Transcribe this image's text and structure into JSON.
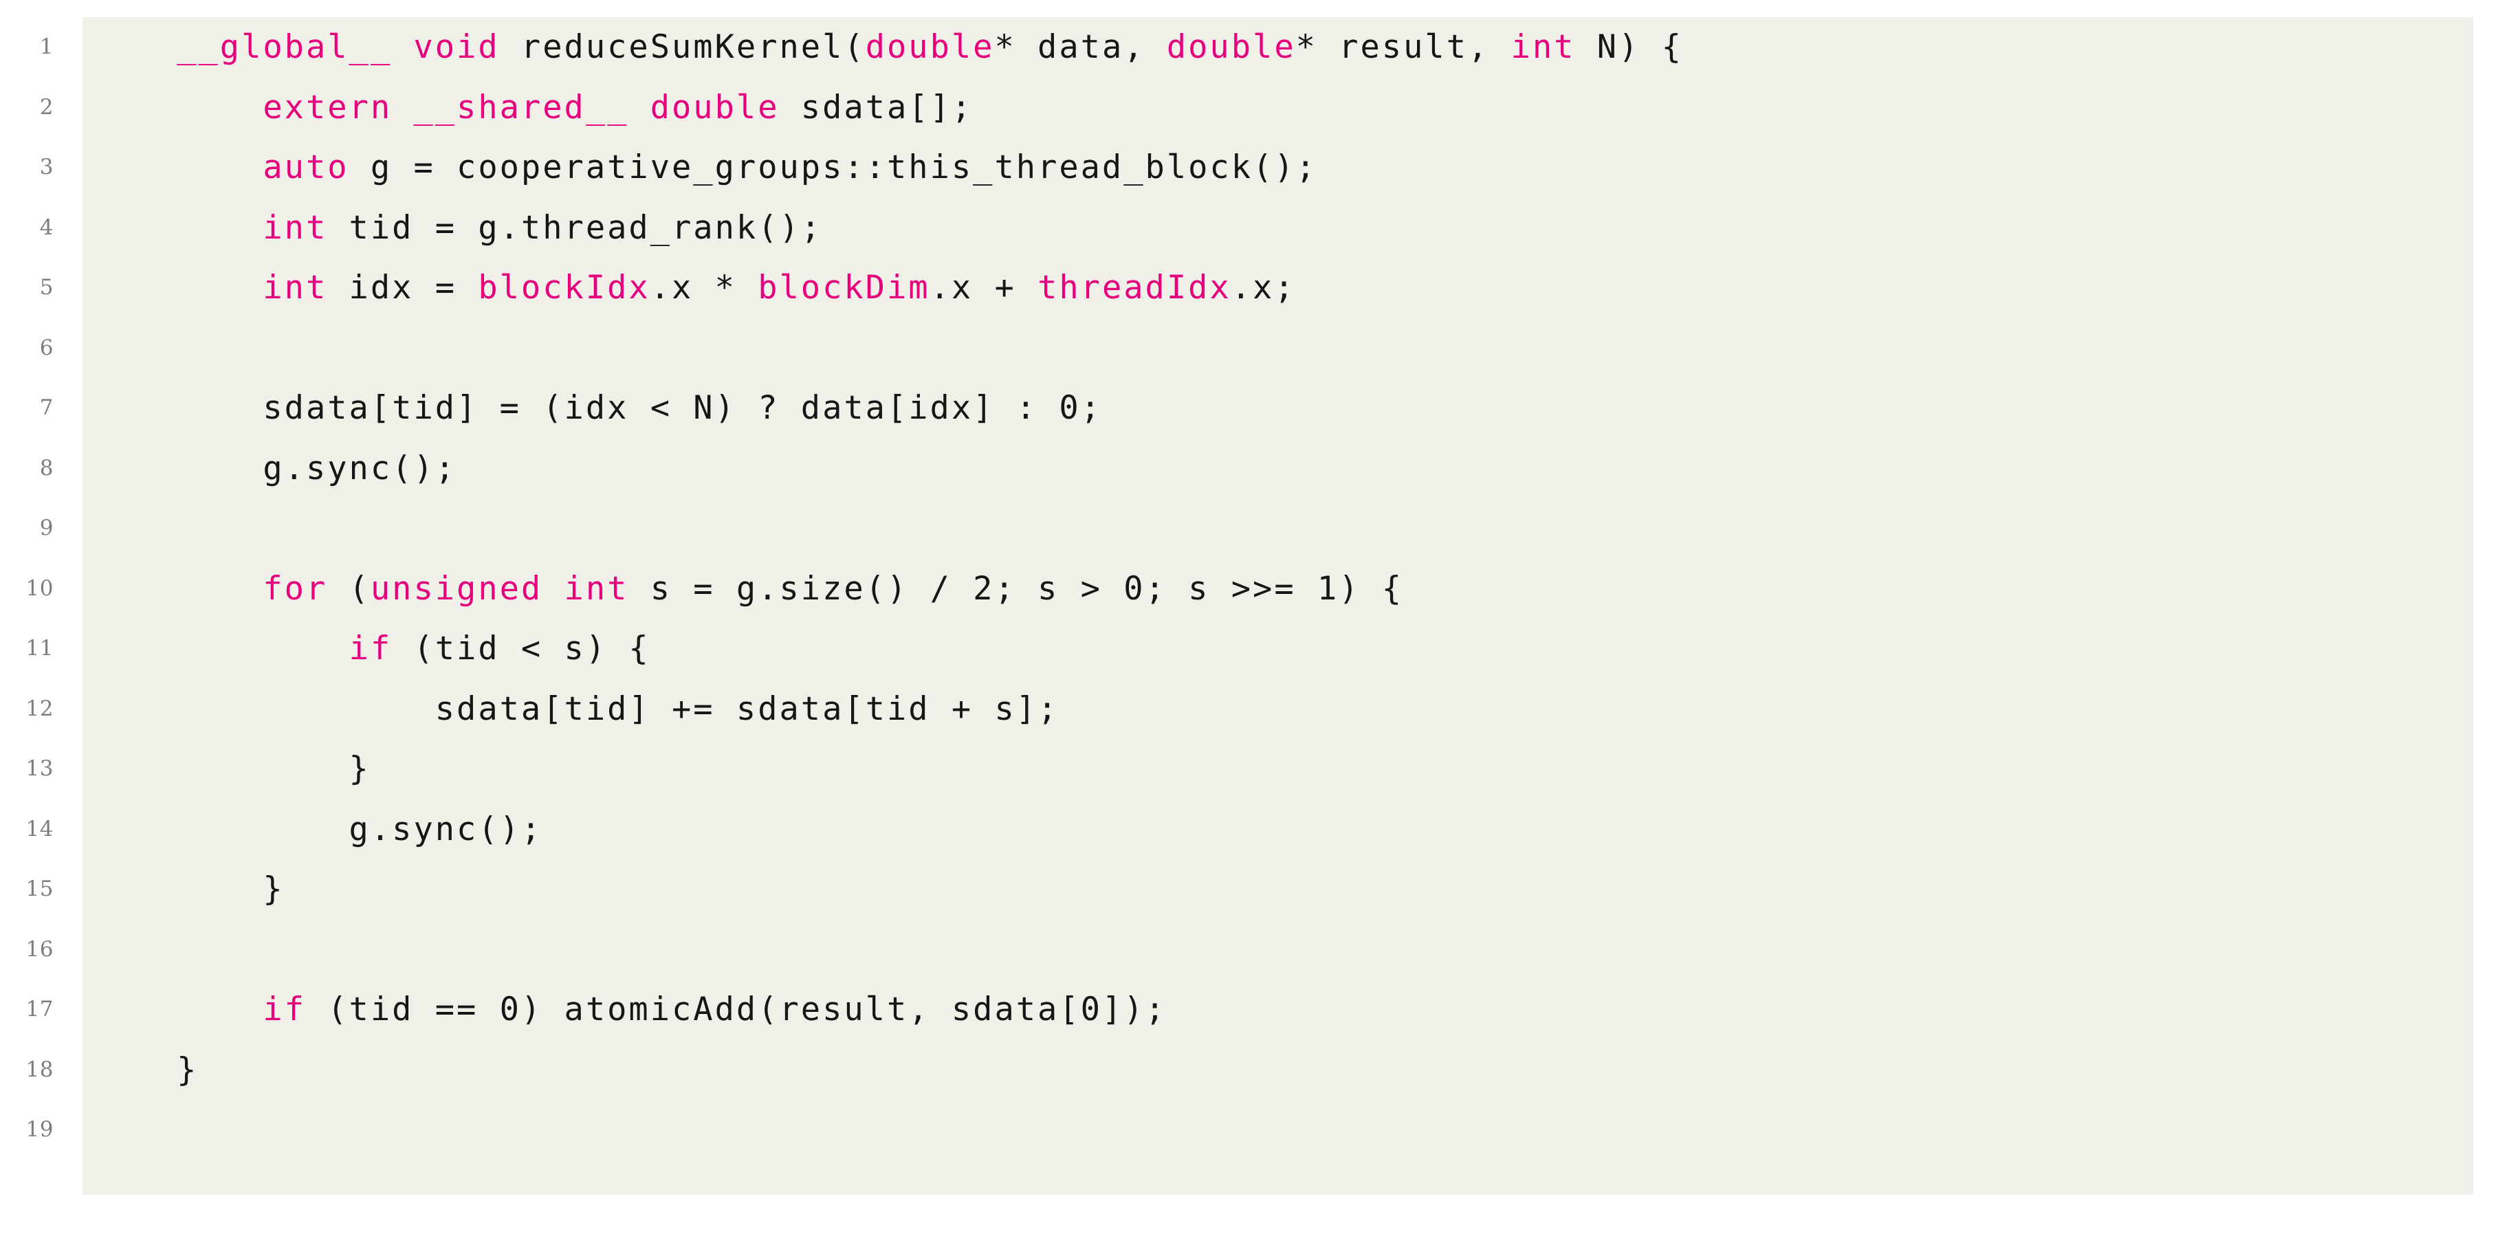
{
  "listing": {
    "language": "cuda-cpp",
    "background_color": "#f1f0e8",
    "page_color": "#ffffff",
    "keyword_color": "#e6007e",
    "text_color": "#161616",
    "lineno_color": "#7d7d7d",
    "first_line_number": 1,
    "last_line_number": 19,
    "line_numbers": [
      "1",
      "2",
      "3",
      "4",
      "5",
      "6",
      "7",
      "8",
      "9",
      "10",
      "11",
      "12",
      "13",
      "14",
      "15",
      "16",
      "17",
      "18",
      "19"
    ],
    "lines": [
      {
        "number": "1",
        "text": "    __global__ void reduceSumKernel(double* data, double* result, int N) {",
        "tokens": [
          {
            "t": "    ",
            "k": false
          },
          {
            "t": "__global__",
            "k": true
          },
          {
            "t": " ",
            "k": false
          },
          {
            "t": "void",
            "k": true
          },
          {
            "t": " reduceSumKernel(",
            "k": false
          },
          {
            "t": "double",
            "k": true
          },
          {
            "t": "* data, ",
            "k": false
          },
          {
            "t": "double",
            "k": true
          },
          {
            "t": "* result, ",
            "k": false
          },
          {
            "t": "int",
            "k": true
          },
          {
            "t": " N) {",
            "k": false
          }
        ]
      },
      {
        "number": "2",
        "text": "        extern __shared__ double sdata[];",
        "tokens": [
          {
            "t": "        ",
            "k": false
          },
          {
            "t": "extern",
            "k": true
          },
          {
            "t": " ",
            "k": false
          },
          {
            "t": "__shared__",
            "k": true
          },
          {
            "t": " ",
            "k": false
          },
          {
            "t": "double",
            "k": true
          },
          {
            "t": " sdata[];",
            "k": false
          }
        ]
      },
      {
        "number": "3",
        "text": "        auto g = cooperative_groups::this_thread_block();",
        "tokens": [
          {
            "t": "        ",
            "k": false
          },
          {
            "t": "auto",
            "k": true
          },
          {
            "t": " g = cooperative_groups::this_thread_block();",
            "k": false
          }
        ]
      },
      {
        "number": "4",
        "text": "        int tid = g.thread_rank();",
        "tokens": [
          {
            "t": "        ",
            "k": false
          },
          {
            "t": "int",
            "k": true
          },
          {
            "t": " tid = g.thread_rank();",
            "k": false
          }
        ]
      },
      {
        "number": "5",
        "text": "        int idx = blockIdx.x * blockDim.x + threadIdx.x;",
        "tokens": [
          {
            "t": "        ",
            "k": false
          },
          {
            "t": "int",
            "k": true
          },
          {
            "t": " idx = ",
            "k": false
          },
          {
            "t": "blockIdx",
            "k": true
          },
          {
            "t": ".x * ",
            "k": false
          },
          {
            "t": "blockDim",
            "k": true
          },
          {
            "t": ".x + ",
            "k": false
          },
          {
            "t": "threadIdx",
            "k": true
          },
          {
            "t": ".x;",
            "k": false
          }
        ]
      },
      {
        "number": "6",
        "text": "",
        "tokens": []
      },
      {
        "number": "7",
        "text": "        sdata[tid] = (idx < N) ? data[idx] : 0;",
        "tokens": [
          {
            "t": "        sdata[tid] = (idx < N) ? data[idx] : 0;",
            "k": false
          }
        ]
      },
      {
        "number": "8",
        "text": "        g.sync();",
        "tokens": [
          {
            "t": "        g.sync();",
            "k": false
          }
        ]
      },
      {
        "number": "9",
        "text": "",
        "tokens": []
      },
      {
        "number": "10",
        "text": "        for (unsigned int s = g.size() / 2; s > 0; s >>= 1) {",
        "tokens": [
          {
            "t": "        ",
            "k": false
          },
          {
            "t": "for",
            "k": true
          },
          {
            "t": " (",
            "k": false
          },
          {
            "t": "unsigned",
            "k": true
          },
          {
            "t": " ",
            "k": false
          },
          {
            "t": "int",
            "k": true
          },
          {
            "t": " s = g.size() / 2; s > 0; s >>= 1) {",
            "k": false
          }
        ]
      },
      {
        "number": "11",
        "text": "            if (tid < s) {",
        "tokens": [
          {
            "t": "            ",
            "k": false
          },
          {
            "t": "if",
            "k": true
          },
          {
            "t": " (tid < s) {",
            "k": false
          }
        ]
      },
      {
        "number": "12",
        "text": "                sdata[tid] += sdata[tid + s];",
        "tokens": [
          {
            "t": "                sdata[tid] += sdata[tid + s];",
            "k": false
          }
        ]
      },
      {
        "number": "13",
        "text": "            }",
        "tokens": [
          {
            "t": "            }",
            "k": false
          }
        ]
      },
      {
        "number": "14",
        "text": "            g.sync();",
        "tokens": [
          {
            "t": "            g.sync();",
            "k": false
          }
        ]
      },
      {
        "number": "15",
        "text": "        }",
        "tokens": [
          {
            "t": "        }",
            "k": false
          }
        ]
      },
      {
        "number": "16",
        "text": "",
        "tokens": []
      },
      {
        "number": "17",
        "text": "        if (tid == 0) atomicAdd(result, sdata[0]);",
        "tokens": [
          {
            "t": "        ",
            "k": false
          },
          {
            "t": "if",
            "k": true
          },
          {
            "t": " (tid == 0) atomicAdd(result, sdata[0]);",
            "k": false
          }
        ]
      },
      {
        "number": "18",
        "text": "    }",
        "tokens": [
          {
            "t": "    }",
            "k": false
          }
        ]
      },
      {
        "number": "19",
        "text": "",
        "tokens": []
      }
    ]
  }
}
